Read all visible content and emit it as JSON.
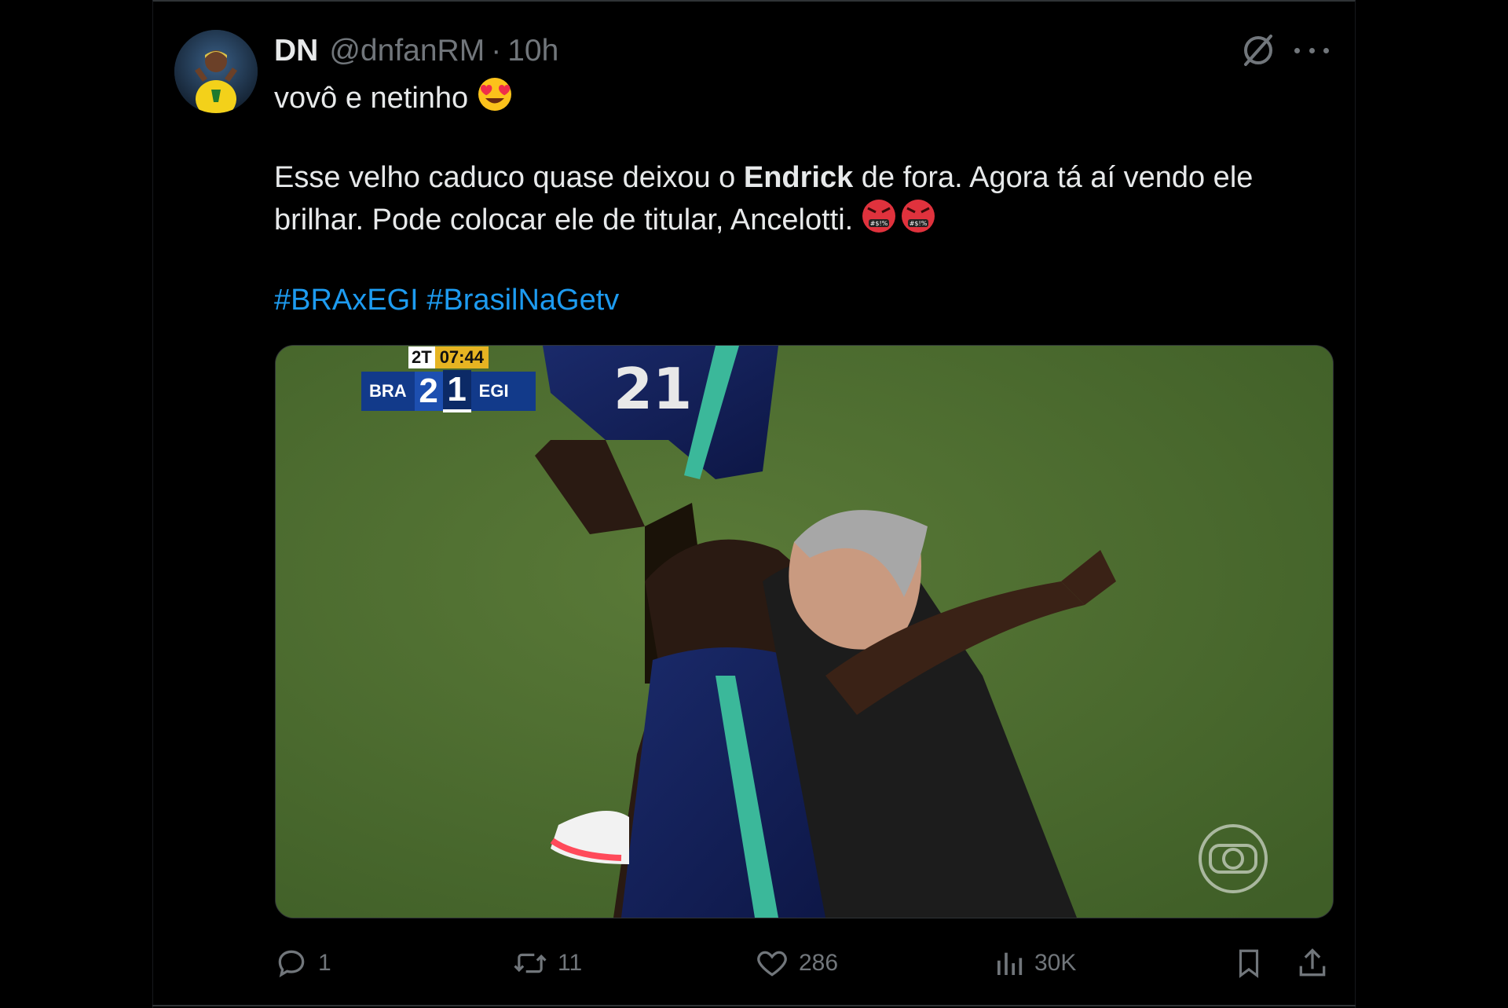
{
  "tweet": {
    "author_name": "DN",
    "author_handle": "@dnfanRM",
    "separator": "·",
    "time": "10h",
    "line1": "vovô e netinho",
    "line2_pre": "Esse velho caduco quase deixou o ",
    "line2_bold": "Endrick",
    "line2_post": " de fora. Agora tá aí vendo ele",
    "line3": "brilhar. Pode colocar ele de titular, Ancelotti.",
    "hashtags": [
      "#BRAxEGI",
      "#BrasilNaGetv"
    ],
    "emojis": {
      "heart_eyes": "smiling-face-with-heart-eyes",
      "angry": "face-with-symbols-on-mouth"
    }
  },
  "media": {
    "scorebug": {
      "half": "2T",
      "clock": "07:44",
      "team_home": "BRA",
      "score_home": "2",
      "score_away": "1",
      "team_away": "EGI"
    },
    "player_number": "21"
  },
  "actions": {
    "replies": "1",
    "reposts": "11",
    "likes": "286",
    "views": "30K"
  },
  "colors": {
    "background": "#000000",
    "text": "#e7e9ea",
    "muted": "#71767b",
    "link": "#1d9bf0",
    "pitch": "#4d6b2f"
  }
}
